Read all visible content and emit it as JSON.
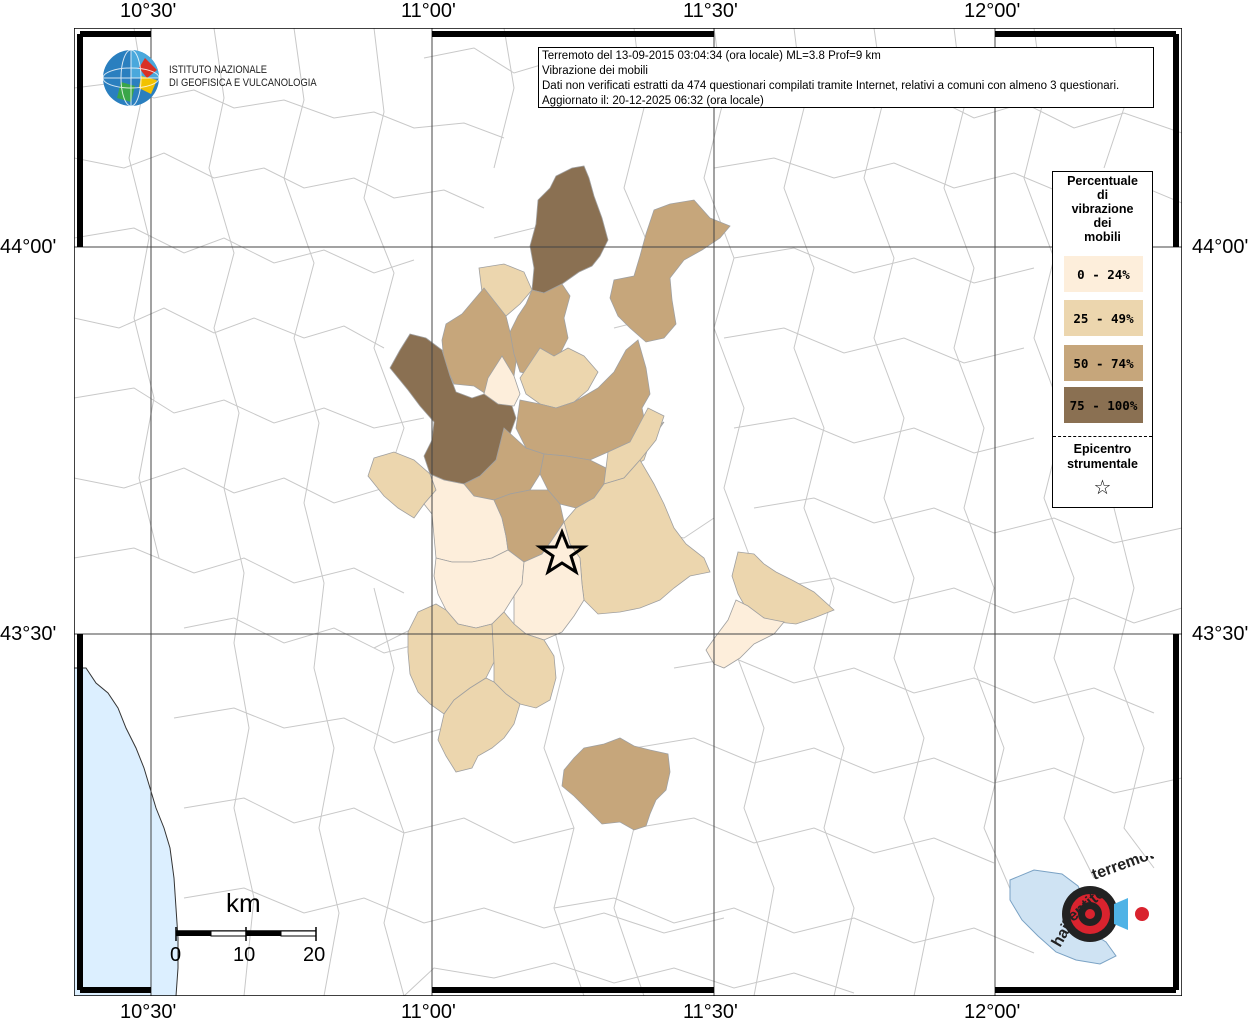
{
  "map": {
    "top_ticks": [
      "10°30'",
      "11°00'",
      "11°30'",
      "12°00'"
    ],
    "bottom_ticks": [
      "10°30'",
      "11°00'",
      "11°30'",
      "12°00'"
    ],
    "left_ticks": [
      "44°00'",
      "43°30'"
    ],
    "right_ticks": [
      "44°00'",
      "43°30'"
    ]
  },
  "info": {
    "line1": "Terremoto del 13-09-2015 03:04:34 (ora locale) ML=3.8 Prof=9 km",
    "line2": "Vibrazione dei mobili",
    "line3": "Dati non verificati estratti da 474 questionari compilati tramite Internet, relativi a comuni con almeno 3 questionari.",
    "line4": "Aggiornato il: 20-12-2025 06:32 (ora locale)"
  },
  "institute": {
    "line1": "ISTITUTO NAZIONALE",
    "line2": "DI GEOFISICA E VULCANOLOGIA"
  },
  "legend": {
    "title_lines": [
      "Percentuale",
      "di",
      "vibrazione",
      "dei",
      "mobili"
    ],
    "items": [
      {
        "label": "0 - 24%",
        "color": "#fdeedb"
      },
      {
        "label": "25 - 49%",
        "color": "#ecd6ae"
      },
      {
        "label": "50 - 74%",
        "color": "#c6a67b"
      },
      {
        "label": "75 - 100%",
        "color": "#8a7052"
      }
    ],
    "epicenter_line1": "Epicentro",
    "epicenter_line2": "strumentale",
    "epicenter_symbol": "☆"
  },
  "scale": {
    "unit": "km",
    "labels": [
      "0",
      "10",
      "20"
    ]
  },
  "colors": {
    "sea": "#dcefff",
    "border": "#c8c8c8",
    "grid": "#444444"
  }
}
